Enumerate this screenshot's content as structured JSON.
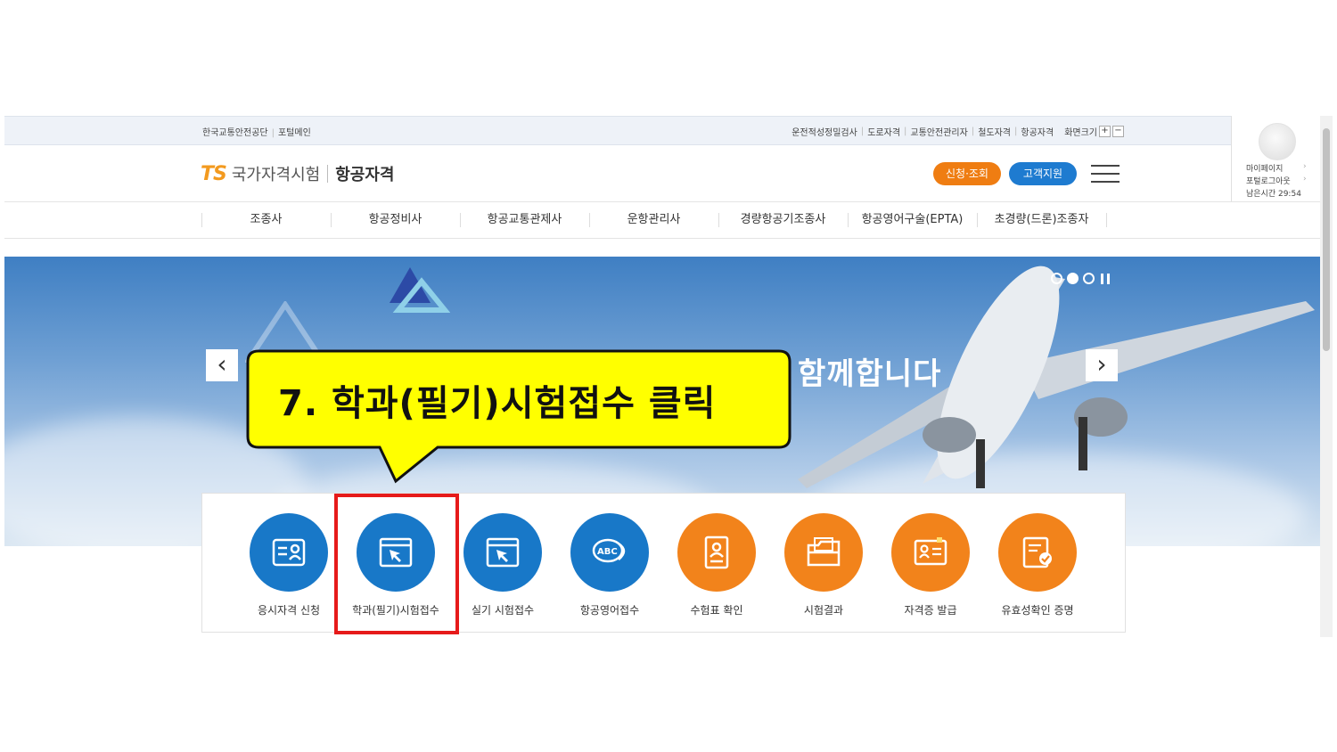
{
  "utility_bar": {
    "left_links": [
      "한국교통안전공단",
      "포털메인"
    ],
    "right_links": [
      "운전적성정밀검사",
      "도로자격",
      "교통안전관리자",
      "철도자격",
      "항공자격"
    ],
    "font_size_label": "화면크기",
    "font_plus": "+",
    "font_minus": "−"
  },
  "user_panel": {
    "links": [
      "마이페이지",
      "포털로그아웃",
      "남은시간 29:54"
    ]
  },
  "header": {
    "logo_ts": "TS",
    "logo_main": "국가자격시험",
    "logo_sub": "항공자격",
    "apply_button": "신청·조회",
    "support_button": "고객지원"
  },
  "gnb": [
    "조종사",
    "항공정비사",
    "항공교통관제사",
    "운항관리사",
    "경량항공기조종사",
    "항공영어구술(EPTA)",
    "초경량(드론)조종자"
  ],
  "hero": {
    "text": "함께합니다",
    "prev": "‹",
    "next": "›",
    "slide_count": 3,
    "active_slide": 2
  },
  "quick_menu": [
    {
      "label": "응시자격 신청",
      "color": "blue",
      "icon": "id-card-icon"
    },
    {
      "label": "학과(필기)시험접수",
      "color": "blue",
      "icon": "cursor-window-icon"
    },
    {
      "label": "실기 시험접수",
      "color": "blue",
      "icon": "cursor-window-icon"
    },
    {
      "label": "항공영어접수",
      "color": "blue",
      "icon": "abc-speech-icon"
    },
    {
      "label": "수험표 확인",
      "color": "orange",
      "icon": "ticket-icon"
    },
    {
      "label": "시험결과",
      "color": "orange",
      "icon": "folder-icon"
    },
    {
      "label": "자격증 발급",
      "color": "orange",
      "icon": "license-card-icon"
    },
    {
      "label": "유효성확인 증명",
      "color": "orange",
      "icon": "verified-doc-icon"
    }
  ],
  "callout": {
    "text": "7. 학과(필기)시험접수 클릭"
  },
  "colors": {
    "blue": "#1878c8",
    "orange": "#f2831b",
    "highlight": "#e61a1a",
    "callout_fill": "#ffff00"
  }
}
